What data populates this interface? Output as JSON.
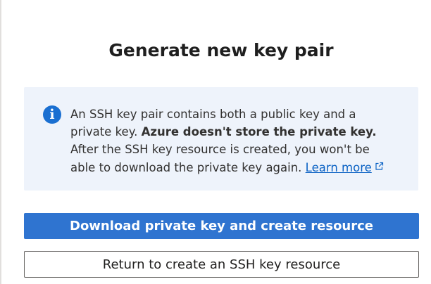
{
  "dialog": {
    "title": "Generate new key pair",
    "info": {
      "icon": "info-icon",
      "line1": "An SSH key pair contains both a public key and a",
      "line2_plain": "private key. ",
      "line2_bold": "Azure doesn't store the private key.",
      "line3": "After the SSH key resource is created, you won't be",
      "line4": "able to download the private key again.",
      "learn_more": "Learn more",
      "link_icon": "external-link-icon"
    },
    "primary_button": "Download private key and create resource",
    "secondary_button": "Return to create an SSH key resource"
  },
  "colors": {
    "accent": "#2f74d0",
    "info_background": "#eef3fb",
    "info_icon": "#1a6fd1",
    "link": "#0b62c4"
  }
}
